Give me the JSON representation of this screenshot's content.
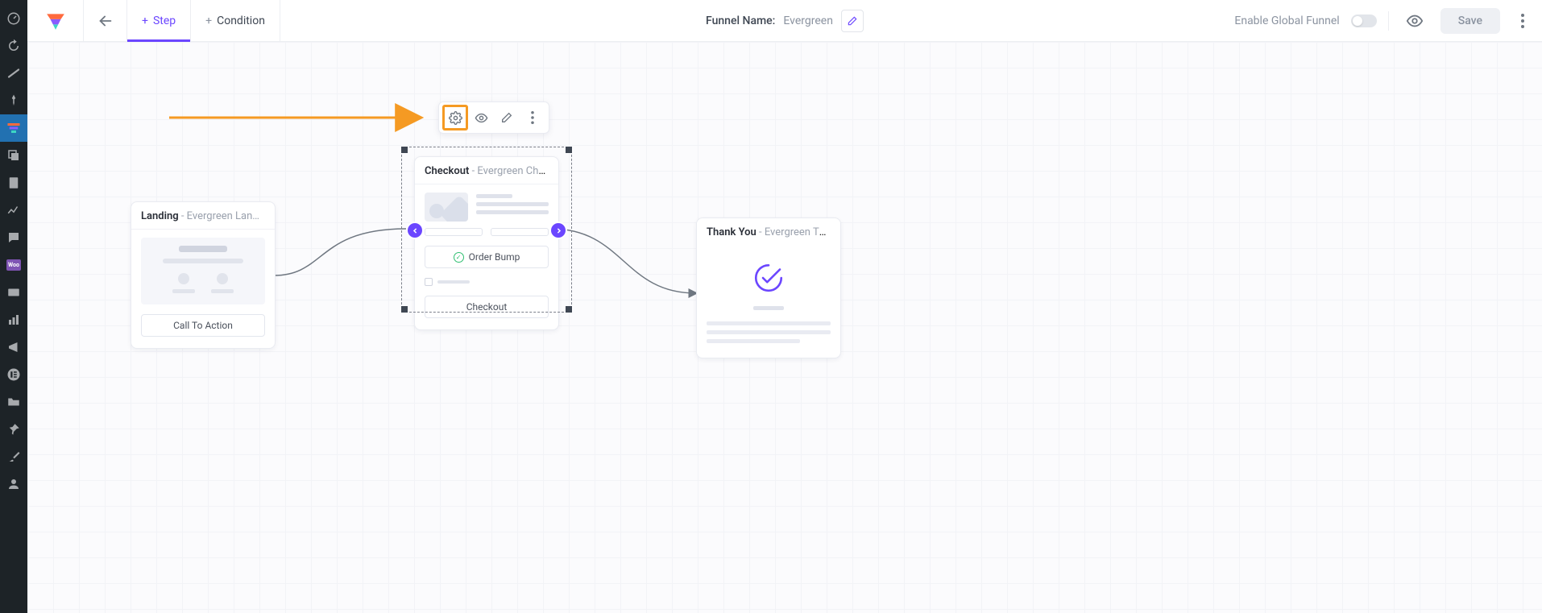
{
  "topbar": {
    "tab_step": "Step",
    "tab_condition": "Condition",
    "funnel_name_label": "Funnel Name:",
    "funnel_name_value": "Evergreen",
    "global_label": "Enable Global Funnel",
    "save_label": "Save"
  },
  "nodes": {
    "landing": {
      "title": "Landing",
      "desc": " - Evergreen Lan…",
      "cta": "Call To Action"
    },
    "checkout": {
      "title": "Checkout",
      "desc": " - Evergreen Che…",
      "bump": "Order Bump",
      "checkout_btn": "Checkout"
    },
    "thankyou": {
      "title": "Thank You",
      "desc": " - Evergreen Tha…"
    }
  },
  "icons": {
    "plus": "+"
  }
}
